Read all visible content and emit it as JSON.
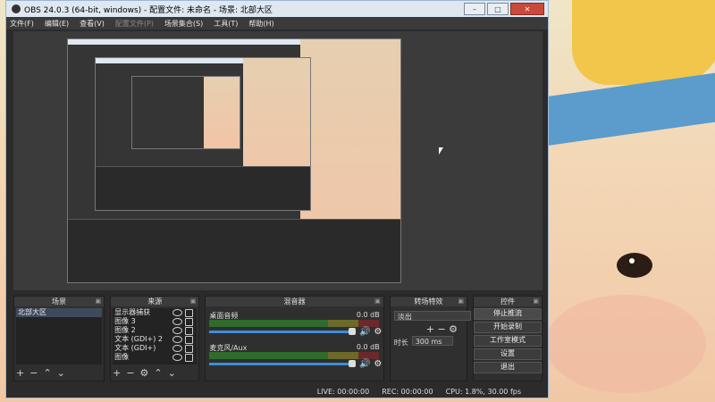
{
  "window": {
    "title": "OBS 24.0.3 (64-bit, windows) - 配置文件: 未命名 - 场景: 北部大区"
  },
  "menu": [
    "文件(F)",
    "编辑(E)",
    "查看(V)",
    "配置文件(P)",
    "场景集合(S)",
    "工具(T)",
    "帮助(H)"
  ],
  "docks": {
    "scenes": {
      "title": "场景",
      "items": [
        "北部大区"
      ]
    },
    "sources": {
      "title": "来源",
      "items": [
        "显示器捕获",
        "图像 3",
        "图像 2",
        "文本 (GDI+) 2",
        "文本 (GDI+)",
        "图像"
      ]
    },
    "mixer": {
      "title": "混音器",
      "channels": [
        {
          "name": "桌面音频",
          "db": "0.0 dB"
        },
        {
          "name": "麦克风/Aux",
          "db": "0.0 dB"
        }
      ]
    },
    "transitions": {
      "title": "转场特效",
      "value": "淡出",
      "duration_label": "时长",
      "duration": "300 ms"
    },
    "controls": {
      "title": "控件",
      "buttons": [
        "停止推流",
        "开始录制",
        "工作室模式",
        "设置",
        "退出"
      ]
    }
  },
  "status": {
    "live": "LIVE: 00:00:00",
    "rec": "REC: 00:00:00",
    "cpu": "CPU: 1.8%, 30.00 fps"
  }
}
